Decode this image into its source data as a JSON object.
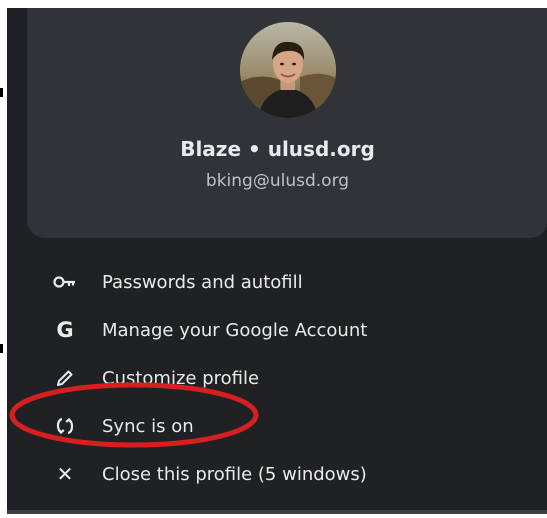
{
  "profile": {
    "name": "Blaze • ulusd.org",
    "email": "bking@ulusd.org",
    "avatar_icon": "user-avatar-photo"
  },
  "menu": {
    "items": [
      {
        "label": "Passwords and autofill",
        "icon": "key-icon"
      },
      {
        "label": "Manage your Google Account",
        "icon": "google-g-icon"
      },
      {
        "label": "Customize profile",
        "icon": "pencil-icon"
      },
      {
        "label": "Sync is on",
        "icon": "sync-icon"
      },
      {
        "label": "Close this profile (5 windows)",
        "icon": "close-icon"
      }
    ]
  },
  "colors": {
    "menu_background": "#1f2124",
    "card_background": "#303438",
    "text_primary": "#e8eaed",
    "text_secondary": "#bdc1c6",
    "annotation_red": "#d61f1f"
  }
}
